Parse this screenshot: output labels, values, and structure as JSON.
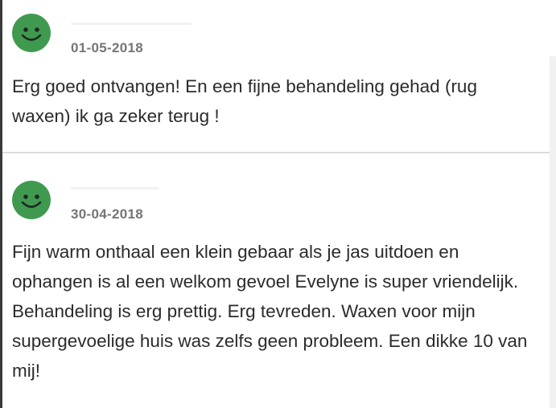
{
  "reviews": [
    {
      "avatar_icon": "smiley-face-icon",
      "avatar_color": "#3f9a50",
      "date": "01-05-2018",
      "text": "Erg goed ontvangen! En een fijne behandeling gehad (rug waxen) ik ga zeker terug !"
    },
    {
      "avatar_icon": "smiley-face-icon",
      "avatar_color": "#3f9a50",
      "date": "30-04-2018",
      "text": "Fijn warm onthaal een klein gebaar als je jas uitdoen en ophangen is al een welkom gevoel Evelyne is super vriendelijk. Behandeling is erg prettig. Erg tevreden. Waxen voor mijn supergevoelige huis was zelfs geen probleem. Een dikke 10 van mij!"
    }
  ]
}
